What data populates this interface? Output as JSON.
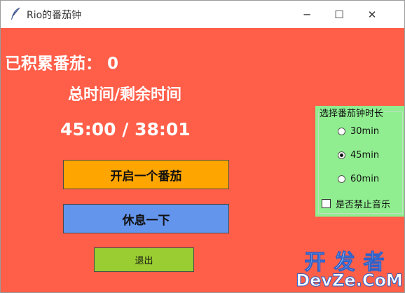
{
  "window": {
    "title": "Rio的番茄钟",
    "icon": "feather-icon",
    "controls": {
      "minimize": "─",
      "maximize": "☐",
      "close": "✕"
    }
  },
  "main": {
    "count_label": "已积累番茄： 0",
    "time_header": "总时间/剩余时间",
    "time_value": "45:00 / 38:01",
    "buttons": {
      "start": "开启一个番茄",
      "rest": "休息一下",
      "exit": "退出"
    }
  },
  "duration_panel": {
    "legend": "选择番茄钟时长",
    "options": [
      {
        "label": "30min",
        "selected": false
      },
      {
        "label": "45min",
        "selected": true
      },
      {
        "label": "60min",
        "selected": false
      }
    ],
    "mute_music": {
      "label": "是否禁止音乐",
      "checked": false
    }
  },
  "watermark": {
    "top": "开发者",
    "bottom": "DevZe.CoM"
  },
  "colors": {
    "background": "#ff5e49",
    "start_button": "#ffa500",
    "rest_button": "#6495ed",
    "exit_button": "#9acd32",
    "panel": "#90ee90"
  }
}
